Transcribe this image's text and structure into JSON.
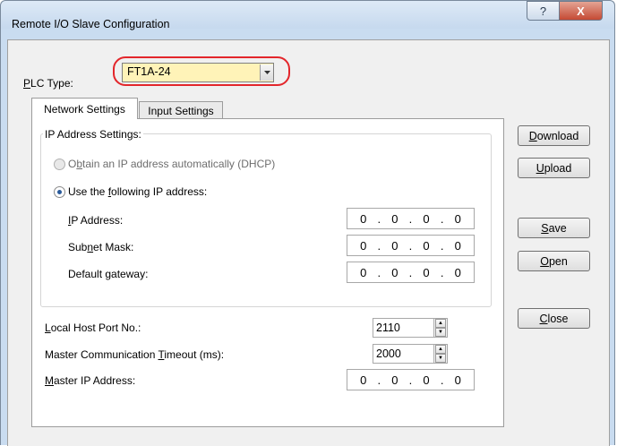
{
  "window": {
    "title": "Remote I/O Slave Configuration",
    "help_glyph": "?",
    "close_glyph": "X"
  },
  "plc_type": {
    "label": "PLC Type:",
    "value": "FT1A-24"
  },
  "tabs": [
    {
      "label": "Network Settings",
      "active": true
    },
    {
      "label": "Input Settings",
      "active": false
    }
  ],
  "ip_settings": {
    "group_label": "IP Address Settings:",
    "dhcp_label": "Obtain an IP address automatically (DHCP)",
    "static_label": "Use the following IP address:",
    "ip_address_label": "IP Address:",
    "subnet_mask_label": "Subnet Mask:",
    "gateway_label": "Default gateway:",
    "ip_address": [
      "0",
      "0",
      "0",
      "0"
    ],
    "subnet_mask": [
      "0",
      "0",
      "0",
      "0"
    ],
    "gateway": [
      "0",
      "0",
      "0",
      "0"
    ]
  },
  "local_host_port": {
    "label": "Local Host Port No.:",
    "value": "2110"
  },
  "master_timeout": {
    "label": "Master Communication Timeout (ms):",
    "value": "2000"
  },
  "master_ip": {
    "label": "Master IP Address:",
    "octets": [
      "0",
      "0",
      "0",
      "0"
    ]
  },
  "buttons": {
    "download": "Download",
    "upload": "Upload",
    "save": "Save",
    "open": "Open",
    "close": "Close"
  },
  "colors": {
    "highlight_ring": "#e3262b",
    "combo_fill": "#fff3b8",
    "radio_dot": "#2a5a9a"
  }
}
